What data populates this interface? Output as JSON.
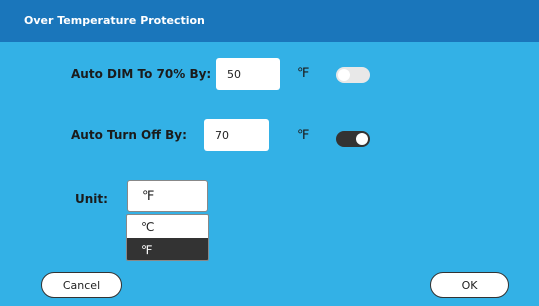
{
  "dialog": {
    "title": "Over Temperature Protection"
  },
  "auto_dim": {
    "label": "Auto DIM To 70% By:",
    "value": "50",
    "unit": "℉",
    "enabled": false
  },
  "auto_off": {
    "label": "Auto Turn Off By:",
    "value": "70",
    "unit": "℉",
    "enabled": true
  },
  "unit_select": {
    "label": "Unit:",
    "selected": "℉",
    "options": [
      "℃",
      "℉"
    ]
  },
  "buttons": {
    "cancel": "Cancel",
    "ok": "OK"
  },
  "colors": {
    "title_bar": "#1a76bb",
    "body": "#33b1e6",
    "toggle_on": "#333333",
    "toggle_off": "#e8e8e8"
  }
}
